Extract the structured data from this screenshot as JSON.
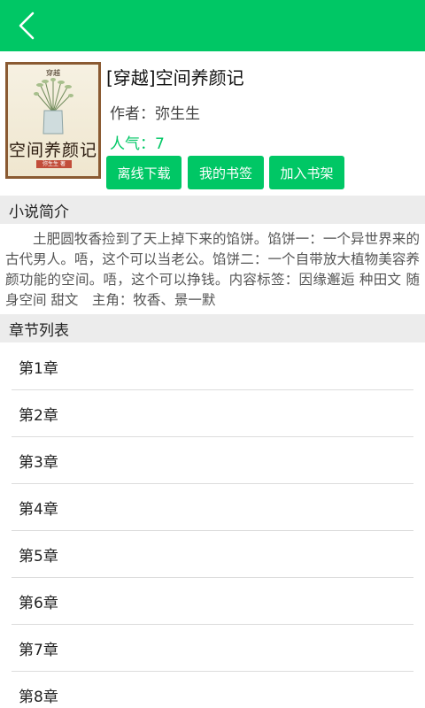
{
  "colors": {
    "accent": "#00c765",
    "section_bg": "#ececec"
  },
  "header": {
    "back_icon": "chevron-left-icon"
  },
  "book": {
    "title": "[穿越]空间养颜记",
    "author": "作者：弥生生",
    "popularity": "人气：7",
    "cover": {
      "small_text": "穿越",
      "title": "空间养颜记",
      "author": "弥生生 著"
    }
  },
  "actions": {
    "download_label": "离线下载",
    "bookmark_label": "我的书签",
    "shelf_label": "加入书架"
  },
  "intro": {
    "heading": "小说简介",
    "text": "土肥圆牧香捡到了天上掉下来的馅饼。馅饼一：一个异世界来的古代男人。唔，这个可以当老公。馅饼二：一个自带放大植物美容养颜功能的空间。唔，这个可以挣钱。内容标签：因缘邂逅 种田文 随身空间 甜文　主角：牧香、景一默"
  },
  "chapters": {
    "heading": "章节列表",
    "items": [
      "第1章",
      "第2章",
      "第3章",
      "第4章",
      "第5章",
      "第6章",
      "第7章",
      "第8章"
    ]
  }
}
